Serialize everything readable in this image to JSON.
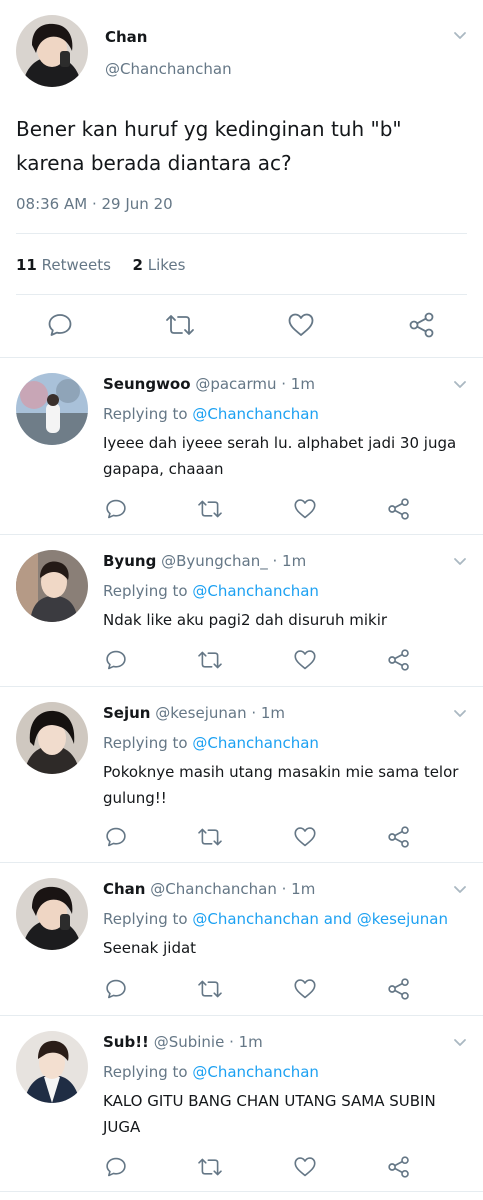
{
  "main_tweet": {
    "name": "Chan",
    "handle": "@Chanchanchan",
    "text": "Bener kan huruf yg kedinginan tuh \"b\" karena berada diantara ac?",
    "timestamp": "08:36 AM · 29 Jun 20",
    "retweet_count": "11",
    "retweet_label": "Retweets",
    "like_count": "2",
    "like_label": "Likes"
  },
  "replying_label": "Replying to",
  "replies": [
    {
      "name": "Seungwoo",
      "handle": "@pacarmu · 1m",
      "replying_to": "@Chanchanchan",
      "text": "Iyeee dah iyeee serah lu. alphabet jadi 30 juga gapapa, chaaan"
    },
    {
      "name": "Byung",
      "handle": "@Byungchan_ · 1m",
      "replying_to": "@Chanchanchan",
      "text": "Ndak like aku pagi2 dah disuruh mikir"
    },
    {
      "name": "Sejun",
      "handle": "@kesejunan · 1m",
      "replying_to": "@Chanchanchan",
      "text": "Pokoknye masih utang masakin mie sama telor gulung!!"
    },
    {
      "name": "Chan",
      "handle": "@Chanchanchan · 1m",
      "replying_to": "@Chanchanchan and @kesejunan",
      "text": "Seenak jidat"
    },
    {
      "name": "Sub!!",
      "handle": "@Subinie · 1m",
      "replying_to": "@Chanchanchan",
      "text": "KALO GITU BANG CHAN UTANG SAMA SUBIN JUGA"
    }
  ],
  "colors": {
    "accent": "#1da1f2",
    "secondary_text": "#657786",
    "icon": "#657786",
    "divider": "#e6ecf0"
  },
  "icons": {
    "reply": "reply-icon",
    "retweet": "retweet-icon",
    "like": "heart-icon",
    "share": "share-icon",
    "more": "chevron-down-icon"
  }
}
